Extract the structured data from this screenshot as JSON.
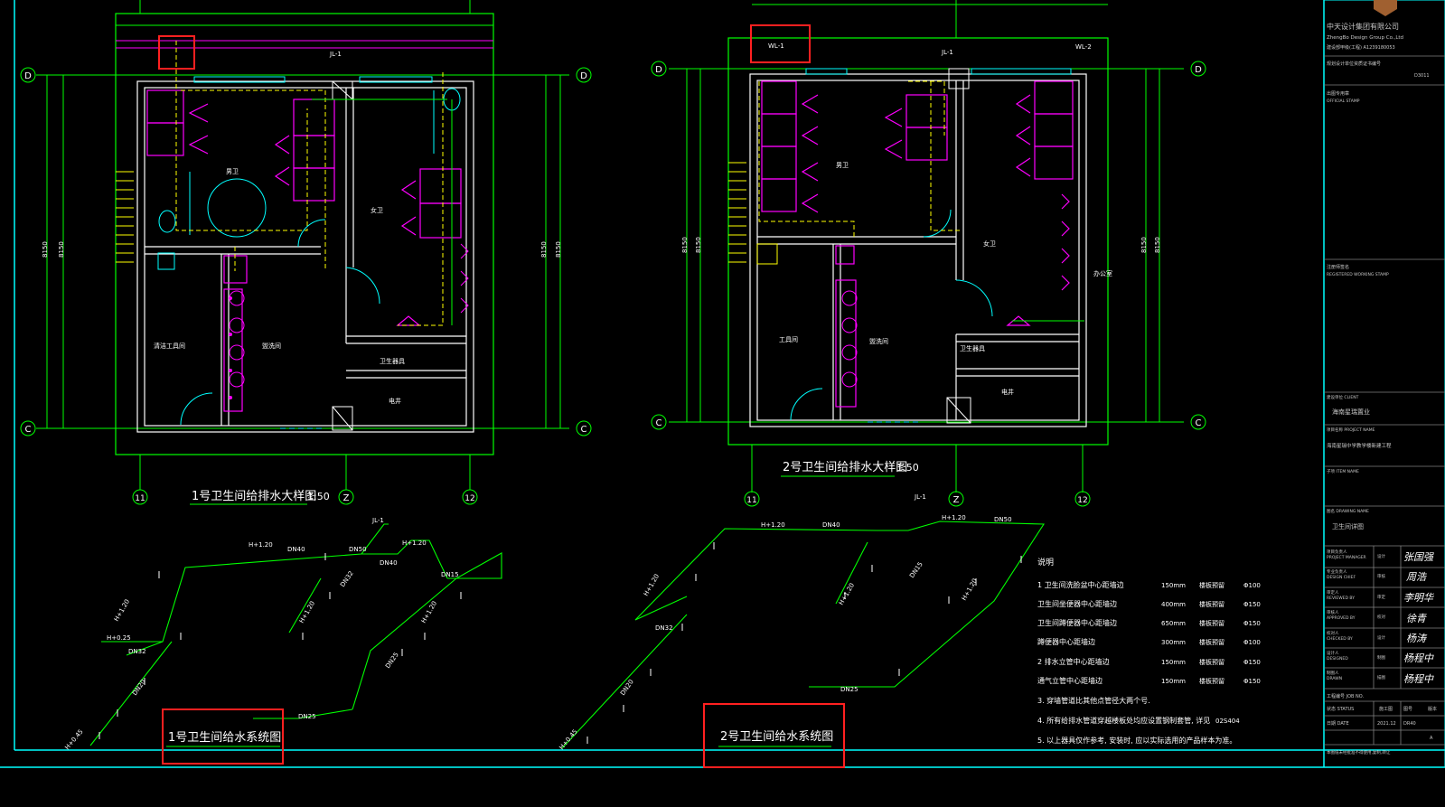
{
  "colors": {
    "background": "#000000",
    "wall": "#ffffff",
    "green": "#00ff00",
    "magenta": "#ff00ff",
    "yellow": "#ffff00",
    "cyan": "#00ffff",
    "highlight": "#ff2020",
    "title_block_gray": "#c8c8c8"
  },
  "plan1": {
    "title": "1号卫生间给排水大样图",
    "scale": "1:50",
    "riser_label": "JL-1",
    "dims": [
      "8150",
      "8150",
      "8150",
      "8150"
    ],
    "axes": {
      "top_left": "D",
      "top_right": "D",
      "bottom_left": "C",
      "bottom_right": "C",
      "b1": "11",
      "b2": "Z",
      "b3": "12"
    },
    "rooms": {
      "mens": "男卫",
      "womens": "女卫",
      "wash": "盥洗间",
      "storage": "卫生器具",
      "elec": "电井",
      "janitor": "清洁工具间"
    }
  },
  "plan2": {
    "title": "2号卫生间给排水大样图",
    "scale": "1:50",
    "riser_labels": [
      "WL-1",
      "JL-1",
      "WL-2"
    ],
    "dims": [
      "8150",
      "8150",
      "8150",
      "8150"
    ],
    "axes": {
      "top_left": "D",
      "top_right": "D",
      "bottom_left": "C",
      "bottom_right": "C",
      "b1": "11",
      "b2": "Z",
      "b3": "12"
    },
    "rooms": {
      "mens": "男卫",
      "womens": "女卫",
      "wash": "盥洗间",
      "storage": "卫生器具",
      "elec": "电井",
      "tool": "工具间",
      "side": "办公室"
    }
  },
  "system1": {
    "title": "1号卫生间给水系统图",
    "labels": [
      "JL-1",
      "H+1.20",
      "H+1.20",
      "H+1.20",
      "H+1.20",
      "H+1.20",
      "H+0.25",
      "H+0.45",
      "DN40",
      "DN50",
      "DN40",
      "DN32",
      "DN25",
      "DN15",
      "DN20",
      "DN32",
      "DN25"
    ]
  },
  "system2": {
    "title": "2号卫生间给水系统图",
    "labels": [
      "JL-1",
      "H+1.20",
      "H+1.20",
      "H+1.20",
      "H+1.20",
      "H+1.20",
      "H+0.45",
      "DN40",
      "DN50",
      "DN32",
      "DN25",
      "DN15",
      "DN20"
    ]
  },
  "notes": {
    "heading": "说明",
    "lines": [
      "1  卫生间洗脸盆中心距墙边",
      "   卫生间坐便器中心距墙边",
      "   卫生间蹲便器中心距墙边",
      "   蹲便器中心距墙边",
      "2  排水立管中心距墙边",
      "   通气立管中心距墙边",
      "3. 穿墙管道比其他点管径大两个号.",
      "4. 所有给排水管道穿越楼板处均应设置钢制套管, 详见",
      "5. 以上器具仅作参考, 安装时, 应以实际选用的产品样本为准。"
    ],
    "values": [
      [
        "150mm",
        "楼板预留",
        "Φ100"
      ],
      [
        "400mm",
        "楼板预留",
        "Φ150"
      ],
      [
        "650mm",
        "楼板预留",
        "Φ150"
      ],
      [
        "300mm",
        "楼板预留",
        "Φ100"
      ],
      [
        "150mm",
        "楼板预留",
        "Φ150"
      ],
      [
        "150mm",
        "楼板预留",
        "Φ150"
      ]
    ],
    "ref": "02S404"
  },
  "title_block": {
    "company_cn": "中天设计集团有限公司",
    "company_en": "ZhengBo Design Group Co.,Ltd",
    "cert": "建设部甲级(工程) A1239180053",
    "line2": "规划设计单位资质证书编号",
    "project_no": "D3011",
    "stamp_label": "出图专用章",
    "stamp_en": "OFFICIAL STAMP",
    "reg_label": "注册师签名",
    "reg_en": "REGISTERED WORKING STAMP",
    "client_label": "建设单位 CLIENT",
    "client": "海南星瑞置业",
    "project_label": "项目名称 PROJECT NAME",
    "project": "海南星瑞中学教学楼新建工程",
    "subitem_label": "子项 ITEM NAME",
    "drawing_label": "图名 DRAWING NAME",
    "drawing": "卫生间详图",
    "roles": [
      [
        "项目负责人",
        "PROJECT MANAGER",
        "设计",
        "张国强"
      ],
      [
        "专业负责人",
        "DESIGN CHIEF",
        "审核",
        "周浩"
      ],
      [
        "审定人",
        "REVIEWED BY",
        "审定",
        "李明华"
      ],
      [
        "审核人",
        "APPROVED BY",
        "校对",
        "徐青"
      ],
      [
        "校对人",
        "CHECKED BY",
        "设计",
        "杨涛"
      ],
      [
        "设计人",
        "DESIGNED",
        "制图",
        "杨程中"
      ],
      [
        "制图人",
        "DRAWN",
        "描图",
        "杨程中"
      ]
    ],
    "job_no_label": "工程编号 JOB NO.",
    "status_label": "状态 STATUS",
    "status": "施工图",
    "date_label": "日期 DATE",
    "date": "2021.12",
    "sheet_label": "图号",
    "sheet": "DR40",
    "edition_label": "版本",
    "edition": "A",
    "footer": "本图纸未经批准不得使用,复制,转让"
  }
}
